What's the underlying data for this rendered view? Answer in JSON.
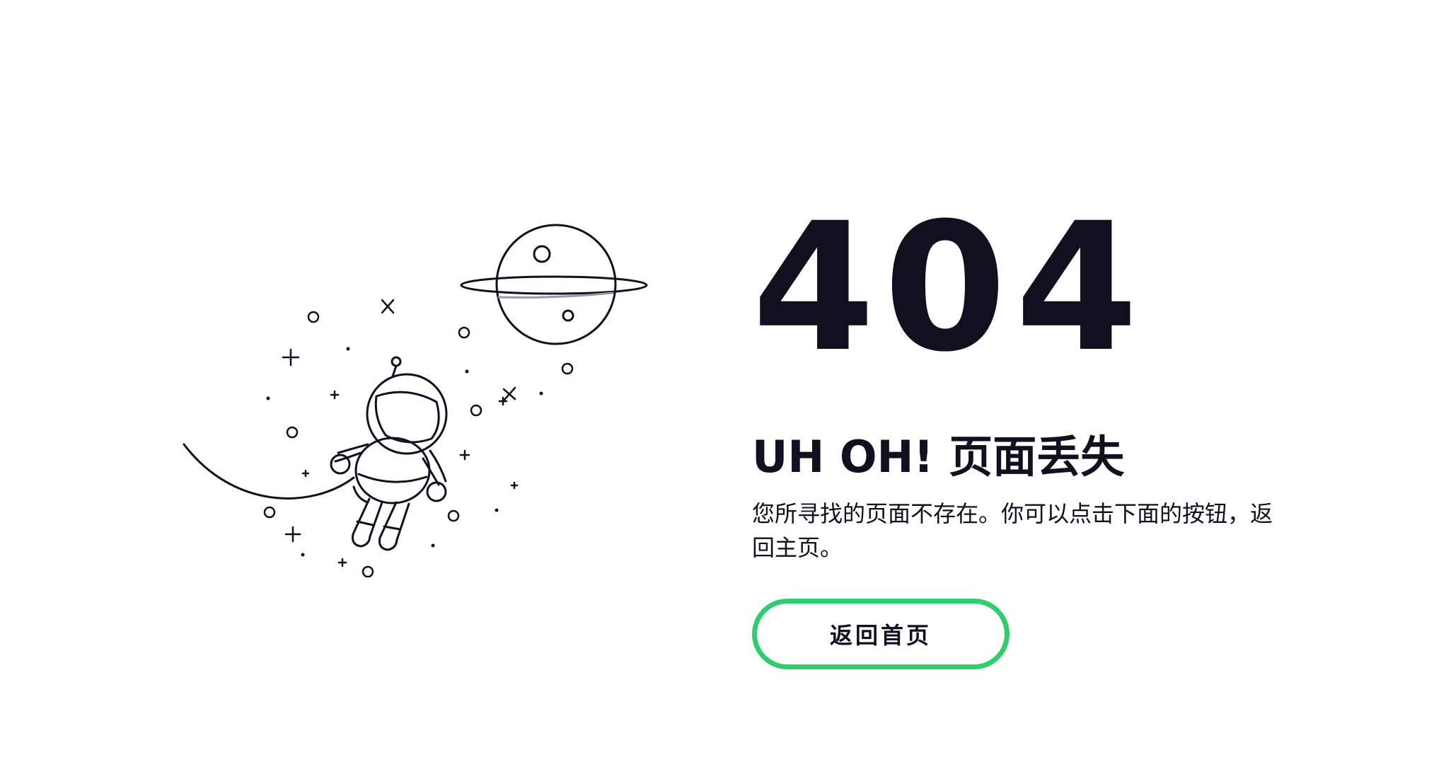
{
  "error": {
    "code": "404",
    "headline": "UH OH! 页面丢失",
    "description": "您所寻找的页面不存在。你可以点击下面的按钮，返回主页。"
  },
  "actions": {
    "home_button_label": "返回首页"
  },
  "colors": {
    "text": "#120f1f",
    "button_border": "#2fcd6e",
    "background": "#ffffff"
  },
  "illustration": {
    "subject": "astronaut floating near ringed planet",
    "icons": [
      "astronaut-icon",
      "planet-icon",
      "star-icon",
      "orbit-icon"
    ]
  }
}
